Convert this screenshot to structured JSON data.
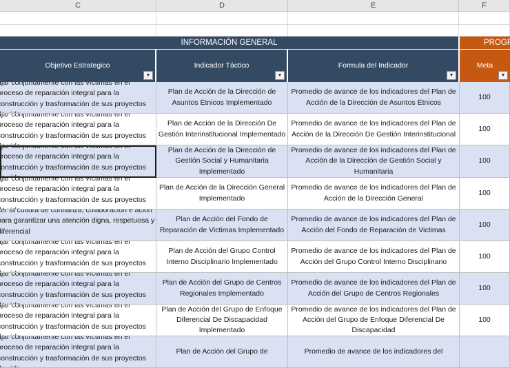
{
  "columns": [
    {
      "letter": "C",
      "selected": true
    },
    {
      "letter": "D",
      "selected": false
    },
    {
      "letter": "E",
      "selected": false
    },
    {
      "letter": "F",
      "selected": false
    }
  ],
  "banners": {
    "general": "INFORMACIÓN GENERAL",
    "programacion": "PROGR"
  },
  "headers": {
    "objetivo": "Objetivo Estrategico",
    "indicador": "Indicador Táctico",
    "formula": "Formula del Indicador",
    "meta": "Meta"
  },
  "filter_glyph": "▼",
  "rows": [
    {
      "objetivo": "ajar conjuntamente con las víctimas en el proceso de reparación integral para la construcción y trasformación de sus proyectos de vida",
      "indicador": "Plan de Acción de la Dirección de Asuntos Étnicos Implementado",
      "formula": "Promedio de avance de los indicadores del Plan de Acción de la Dirección de Asuntos Étnicos",
      "meta": "100",
      "band": true
    },
    {
      "objetivo": "ajar conjuntamente con las víctimas en el proceso de reparación integral para la construcción y trasformación de sus proyectos de vida",
      "indicador": "Plan de Acción de la Dirección De Gestión Interinstitucional Implementado",
      "formula": "Promedio de avance de los indicadores del Plan de Acción de la Dirección De Gestión Interinstitucional",
      "meta": "100",
      "band": false
    },
    {
      "objetivo": "ajar conjuntamente con las víctimas en el proceso de reparación integral para la construcción y trasformación de sus proyectos de vida",
      "indicador": "Plan de Acción de la Dirección de Gestión Social y Humanitaria Implementado",
      "formula": "Promedio de avance de los indicadores del Plan de Acción de la Dirección de Gestión Social y Humanitaria",
      "meta": "100",
      "band": true
    },
    {
      "objetivo": "ajar conjuntamente con las víctimas en el proceso de reparación integral para la construcción y trasformación de sus proyectos de vida",
      "indicador": "Plan de Acción de la Dirección General Implementado",
      "formula": "Promedio de avance de los indicadores del Plan de Acción de la Dirección General",
      "meta": "100",
      "band": false
    },
    {
      "objetivo": "cer la cultura de confianza, colaboración e ación para garantizar una atención digna, respetuosa y diferencial",
      "indicador": "Plan de Acción del Fondo de Reparación de Victimas Implementado",
      "formula": "Promedio de avance de los indicadores del Plan de Acción del Fondo de Reparación de Victimas",
      "meta": "100",
      "band": true
    },
    {
      "objetivo": "ajar conjuntamente con las víctimas en el proceso de reparación integral para la construcción y trasformación de sus proyectos de vida",
      "indicador": "Plan de Acción del Grupo Control Interno Disciplinario Implementado",
      "formula": "Promedio de avance de los indicadores del Plan de Acción del Grupo Control Interno Disciplinario",
      "meta": "100",
      "band": false
    },
    {
      "objetivo": "ajar conjuntamente con las víctimas en el proceso de reparación integral para la construcción y trasformación de sus proyectos de vida",
      "indicador": "Plan de Acción del Grupo de Centros Regionales Implementado",
      "formula": "Promedio de avance de los indicadores del Plan de Acción del Grupo de Centros Regionales",
      "meta": "100",
      "band": true
    },
    {
      "objetivo": "ajar conjuntamente con las víctimas en el proceso de reparación integral para la construcción y trasformación de sus proyectos de vida",
      "indicador": "Plan de Acción del Grupo de Enfoque Diferencial De Discapacidad Implementado",
      "formula": "Promedio de avance de los indicadores del Plan de Acción del Grupo de Enfoque Diferencial De Discapacidad",
      "meta": "100",
      "band": false
    },
    {
      "objetivo": "ajar conjuntamente con las víctimas en el proceso de reparación integral para la construcción y trasformación de sus proyectos de vida",
      "indicador": "Plan de Acción del Grupo de",
      "formula": "Promedio de avance de los indicadores del",
      "meta": "",
      "band": true
    }
  ],
  "colors": {
    "header_navy": "#344a63",
    "header_orange": "#c65911",
    "band_blue": "#d9e1f2"
  }
}
